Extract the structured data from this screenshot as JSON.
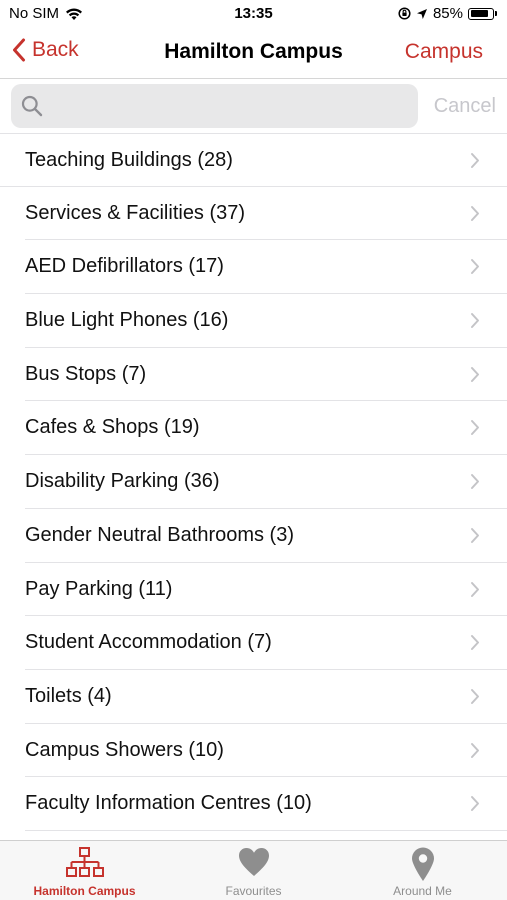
{
  "status_bar": {
    "carrier": "No SIM",
    "time": "13:35",
    "battery": "85%",
    "battery_level": 0.85
  },
  "nav": {
    "back_label": "Back",
    "title": "Hamilton Campus",
    "action_label": "Campus"
  },
  "search": {
    "placeholder": "",
    "value": "",
    "cancel_label": "Cancel"
  },
  "list": {
    "items": [
      {
        "label": "Teaching Buildings (28)"
      },
      {
        "label": "Services & Facilities (37)"
      },
      {
        "label": "AED Defibrillators (17)"
      },
      {
        "label": "Blue Light Phones (16)"
      },
      {
        "label": "Bus Stops (7)"
      },
      {
        "label": "Cafes & Shops (19)"
      },
      {
        "label": "Disability Parking (36)"
      },
      {
        "label": "Gender Neutral Bathrooms (3)"
      },
      {
        "label": "Pay Parking (11)"
      },
      {
        "label": "Student Accommodation (7)"
      },
      {
        "label": "Toilets (4)"
      },
      {
        "label": "Campus Showers (10)"
      },
      {
        "label": "Faculty Information Centres (10)"
      }
    ]
  },
  "tabs": [
    {
      "label": "Hamilton Campus",
      "icon": "sitemap-icon",
      "active": true
    },
    {
      "label": "Favourites",
      "icon": "heart-icon",
      "active": false
    },
    {
      "label": "Around Me",
      "icon": "location-pin-icon",
      "active": false
    }
  ],
  "colors": {
    "accent": "#c6332d",
    "inactive": "#8e8e8e",
    "cancel": "#c7c7cc"
  }
}
